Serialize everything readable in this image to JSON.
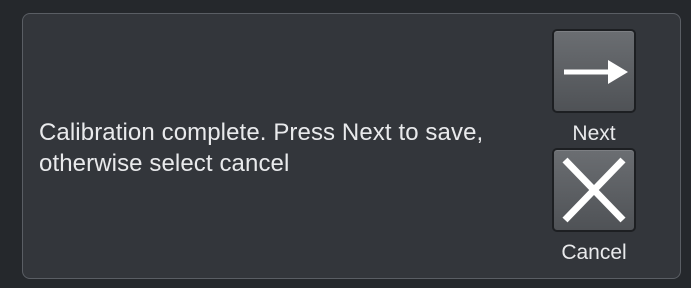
{
  "dialog": {
    "message_line1": "Calibration complete. Press Next to save,",
    "message_line2": "otherwise select cancel"
  },
  "buttons": {
    "next_label": "Next",
    "next_icon": "arrow-right-icon",
    "cancel_label": "Cancel",
    "cancel_icon": "close-icon"
  },
  "colors": {
    "background": "#25282c",
    "panel": "#33363b",
    "text": "#e9eaec",
    "button": "#5d6064"
  }
}
